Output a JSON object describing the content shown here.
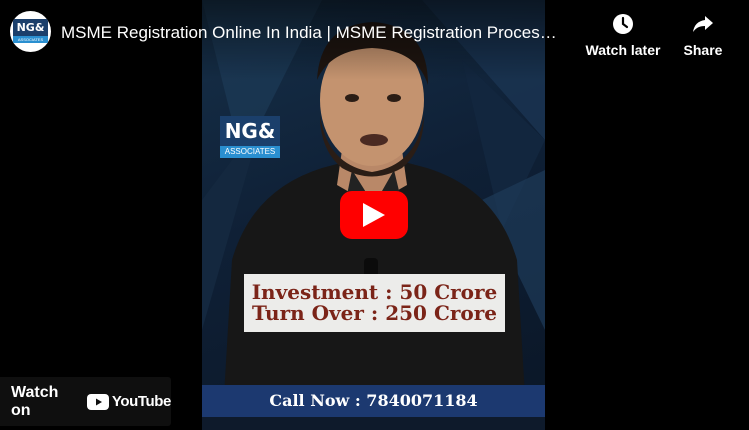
{
  "channel": {
    "avatar_text": "NG&",
    "avatar_subtext": "ASSOCIATES"
  },
  "video": {
    "title": "MSME Registration Online In India | MSME Registration Proces…"
  },
  "controls": {
    "watch_later_label": "Watch later",
    "share_label": "Share"
  },
  "footer": {
    "watch_on_label": "Watch on",
    "platform": "YouTube"
  },
  "frame_content": {
    "logo_text": "NG&",
    "logo_subtext": "ASSOCIATES",
    "info_lines": [
      "Investment : 50 Crore",
      "Turn Over : 250 Crore"
    ],
    "call_text": "Call Now : 7840071184"
  },
  "colors": {
    "play_button": "#ff0000",
    "brand_navy": "#1c3970",
    "card_text": "#7b2418"
  },
  "icons": [
    "clock-icon",
    "share-arrow-icon",
    "play-icon",
    "youtube-icon"
  ]
}
